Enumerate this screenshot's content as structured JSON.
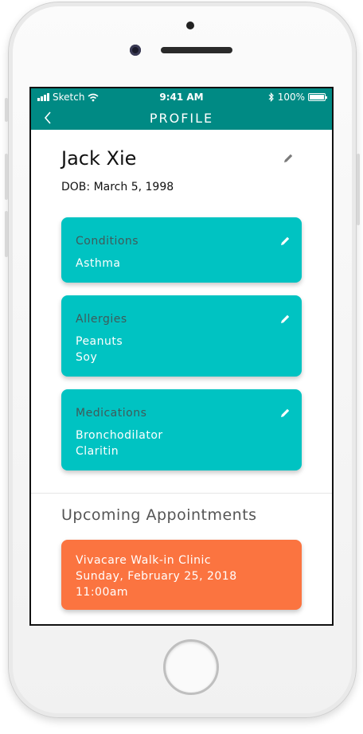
{
  "status_bar": {
    "carrier": "Sketch",
    "time": "9:41 AM",
    "battery": "100%"
  },
  "nav": {
    "title": "PROFILE"
  },
  "profile": {
    "name": "Jack Xie",
    "dob": "DOB: March 5, 1998"
  },
  "cards": [
    {
      "title": "Conditions",
      "items": [
        "Asthma"
      ]
    },
    {
      "title": "Allergies",
      "items": [
        "Peanuts",
        "Soy"
      ]
    },
    {
      "title": "Medications",
      "items": [
        "Bronchodilator",
        "Claritin"
      ]
    }
  ],
  "appointments": {
    "title": "Upcoming Appointments",
    "items": [
      {
        "place": "Vivacare Walk-in Clinic",
        "date": "Sunday, February 25, 2018",
        "time": "11:00am"
      }
    ]
  },
  "colors": {
    "header": "#008a84",
    "card": "#00c3c2",
    "appointment": "#fb7440"
  }
}
